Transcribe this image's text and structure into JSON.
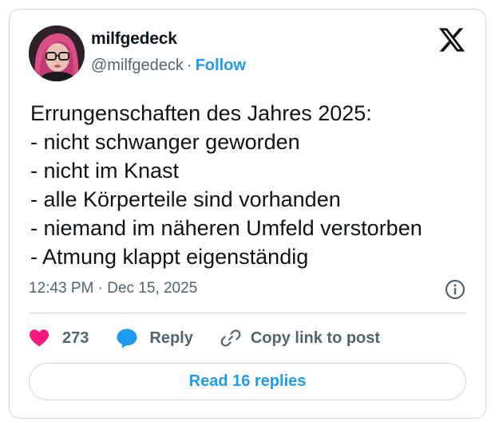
{
  "author": {
    "name": "milfgedeck",
    "handle": "@milfgedeck",
    "separator": "·",
    "follow_label": "Follow"
  },
  "tweet": {
    "lines": [
      "Errungenschaften des Jahres 2025:",
      "- nicht schwanger geworden",
      "- nicht im Knast",
      "- alle Körperteile sind vorhanden",
      "- niemand im näheren Umfeld verstorben",
      "- Atmung klappt eigenständig"
    ],
    "time": "12:43 PM",
    "separator": "·",
    "date": "Dec 15, 2025"
  },
  "actions": {
    "likes_count": "273",
    "reply_label": "Reply",
    "copy_link_label": "Copy link to post"
  },
  "read_replies_label": "Read 16 replies",
  "icons": {
    "brand": "x-logo-icon",
    "info": "info-icon",
    "like": "heart-icon",
    "reply": "speech-bubble-icon",
    "copy": "link-icon"
  },
  "colors": {
    "accent": "#1d9bf0",
    "like": "#f91880",
    "text": "#0f1419",
    "secondary_text": "#536471",
    "border": "#cfd9de"
  }
}
